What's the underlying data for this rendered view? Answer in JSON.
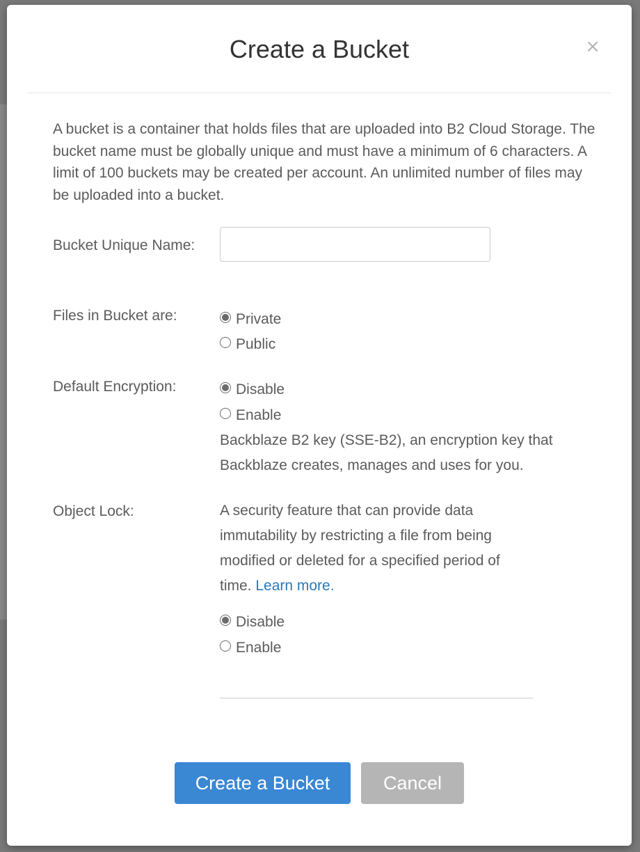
{
  "modal": {
    "title": "Create a Bucket",
    "close_glyph": "×",
    "intro": "A bucket is a container that holds files that are uploaded into B2 Cloud Storage. The bucket name must be globally unique and must have a minimum of 6 characters. A limit of 100 buckets may be created per account. An unlimited number of files may be uploaded into a bucket."
  },
  "bucket_name": {
    "label": "Bucket Unique Name:",
    "value": "",
    "placeholder": ""
  },
  "files_visibility": {
    "label": "Files in Bucket are:",
    "options": [
      {
        "label": "Private",
        "checked": true
      },
      {
        "label": "Public",
        "checked": false
      }
    ]
  },
  "default_encryption": {
    "label": "Default Encryption:",
    "options": [
      {
        "label": "Disable",
        "checked": true
      },
      {
        "label": "Enable",
        "checked": false
      }
    ],
    "help_line1": "Backblaze B2 key (SSE-B2), an encryption key that",
    "help_line2": "Backblaze creates, manages and uses for you."
  },
  "object_lock": {
    "label": "Object Lock:",
    "help_line1": "A security feature that can provide data",
    "help_line2": "immutability by restricting a file from being",
    "help_line3": "modified or deleted for a specified period of",
    "help_line4_prefix": "time. ",
    "learn_more": "Learn more.",
    "options": [
      {
        "label": "Disable",
        "checked": true
      },
      {
        "label": "Enable",
        "checked": false
      }
    ]
  },
  "footer": {
    "create_label": "Create a Bucket",
    "cancel_label": "Cancel"
  },
  "icons": {
    "close": "close-icon",
    "radio_checked": "radio-checked-icon",
    "radio_unchecked": "radio-unchecked-icon"
  },
  "colors": {
    "primary_button": "#3a87d4",
    "cancel_button": "#b5b5b5",
    "link": "#2a7ab8",
    "text": "#5b5b5b"
  }
}
